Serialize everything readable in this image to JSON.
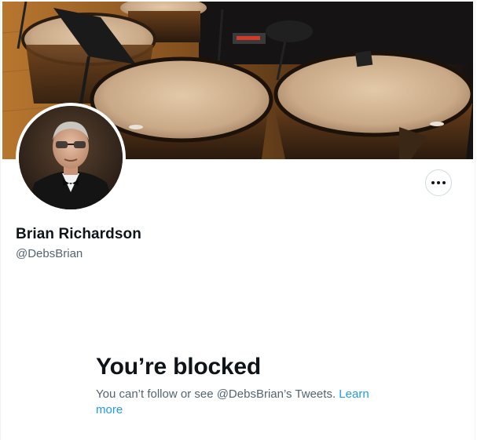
{
  "profile": {
    "display_name": "Brian Richardson",
    "handle": "@DebsBrian"
  },
  "blocked": {
    "title": "You’re blocked",
    "message_prefix": "You can’t follow or see @DebsBrian’s Tweets.",
    "learn_more": "Learn more"
  },
  "icons": {
    "more": "more-horizontal-icon"
  },
  "colors": {
    "text_primary": "#0f1419",
    "text_secondary": "#536471",
    "link": "#1d9bf0",
    "border": "#cfd9de"
  }
}
